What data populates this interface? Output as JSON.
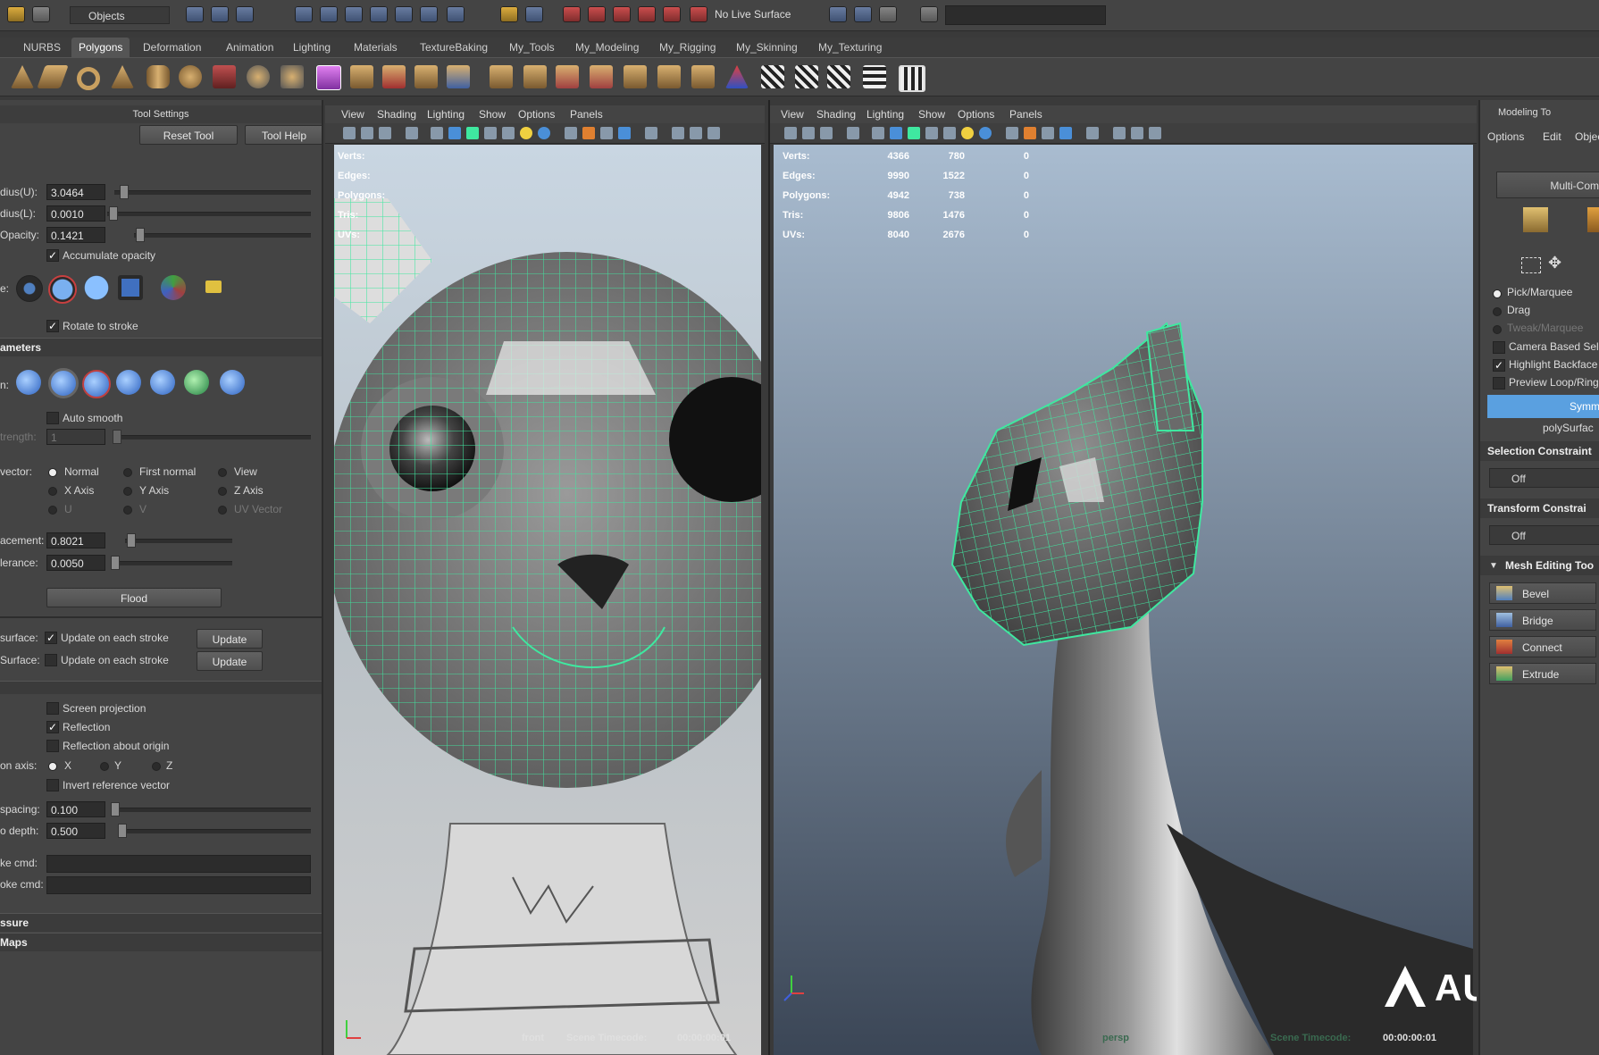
{
  "status_line": {
    "objects_label": "Objects",
    "no_live_surface": "No Live Surface"
  },
  "shelf_tabs": [
    "NURBS",
    "Polygons",
    "Deformation",
    "Animation",
    "Lighting",
    "Materials",
    "TextureBaking",
    "My_Tools",
    "My_Modeling",
    "My_Rigging",
    "My_Skinning",
    "My_Texturing"
  ],
  "active_shelf_tab": "Polygons",
  "tool_settings": {
    "title": "Tool Settings",
    "reset_tool": "Reset Tool",
    "tool_help": "Tool Help",
    "radius_u_label": "dius(U):",
    "radius_u_value": "3.0464",
    "radius_l_label": "dius(L):",
    "radius_l_value": "0.0010",
    "opacity_label": "Opacity:",
    "opacity_value": "0.1421",
    "accumulate_opacity": "Accumulate opacity",
    "profile_label": "e:",
    "rotate_to_stroke": "Rotate to stroke",
    "params_section": "ameters",
    "operation_label": "n:",
    "auto_smooth": "Auto smooth",
    "strength_label": "trength:",
    "strength_value": "1",
    "vector_label": "vector:",
    "vector_options": [
      "Normal",
      "First normal",
      "View",
      "X Axis",
      "Y Axis",
      "Z Axis",
      "U",
      "V",
      "UV Vector"
    ],
    "displacement_label": "acement:",
    "displacement_value": "0.8021",
    "tolerance_label": "lerance:",
    "tolerance_value": "0.0050",
    "flood": "Flood",
    "surface_label_1": "surface:",
    "surface_label_2": "Surface:",
    "update_each_stroke": "Update on each stroke",
    "update": "Update",
    "screen_projection": "Screen projection",
    "reflection": "Reflection",
    "reflection_about_origin": "Reflection about origin",
    "reflection_axis_label": "on axis:",
    "axes": [
      "X",
      "Y",
      "Z"
    ],
    "invert_reference_vector": "Invert reference vector",
    "spacing_label": "spacing:",
    "spacing_value": "0.100",
    "depth_label": "o depth:",
    "depth_value": "0.500",
    "stroke_cmd_1": "ke cmd:",
    "stroke_cmd_2": "oke cmd:",
    "pressure_section": "ssure",
    "maps_section": "Maps"
  },
  "viewport_menus": [
    "View",
    "Shading",
    "Lighting",
    "Show",
    "Options",
    "Panels"
  ],
  "hud": {
    "labels": [
      "Verts:",
      "Edges:",
      "Polygons:",
      "Tris:",
      "UVs:"
    ],
    "right_values": [
      [
        "4366",
        "780",
        "0"
      ],
      [
        "9990",
        "1522",
        "0"
      ],
      [
        "4942",
        "738",
        "0"
      ],
      [
        "9806",
        "1476",
        "0"
      ],
      [
        "8040",
        "2676",
        "0"
      ]
    ]
  },
  "left_viewport": {
    "camera": "front",
    "timecode_label": "Scene Timecode:",
    "timecode": "00:00:00:01"
  },
  "right_viewport": {
    "camera": "persp",
    "timecode_label": "Scene Timecode:",
    "timecode": "00:00:00:01"
  },
  "modeling_toolkit": {
    "title": "Modeling To",
    "menu": [
      "Options",
      "Edit",
      "Objec"
    ],
    "multi_comp": "Multi-Com",
    "pick_marquee": "Pick/Marquee",
    "drag": "Drag",
    "tweak_marquee": "Tweak/Marquee",
    "camera_based": "Camera Based Sele",
    "highlight_backfaces": "Highlight Backface",
    "preview_loop": "Preview Loop/Ring",
    "symmetry": "Symm",
    "poly_surface": "polySurfac",
    "selection_constraint": "Selection Constraint",
    "off_1": "Off",
    "transform_constraint": "Transform Constrai",
    "off_2": "Off",
    "mesh_editing": "Mesh Editing Too",
    "tools": [
      "Bevel",
      "Bridge",
      "Connect",
      "Extrude"
    ]
  },
  "watermark": "AUTODES",
  "colors": {
    "wireframe": "#3fe8a0",
    "viewport_top": "#a9bcd0",
    "viewport_bottom": "#3b4656",
    "symmetry_bar": "#5aa0e0"
  }
}
